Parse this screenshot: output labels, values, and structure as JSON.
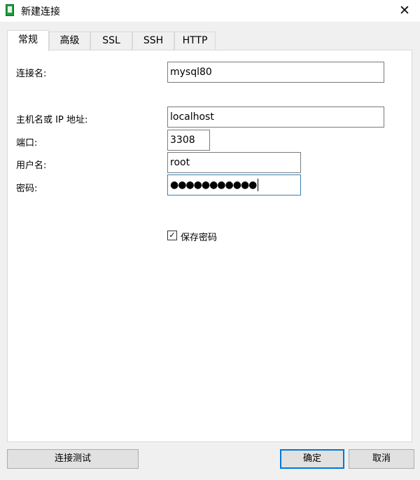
{
  "window": {
    "title": "新建连接"
  },
  "tabs": [
    {
      "label": "常规",
      "active": true
    },
    {
      "label": "高级",
      "active": false
    },
    {
      "label": "SSL",
      "active": false
    },
    {
      "label": "SSH",
      "active": false
    },
    {
      "label": "HTTP",
      "active": false
    }
  ],
  "form": {
    "connection_name_label": "连接名:",
    "connection_name_value": "mysql80",
    "host_label": "主机名或 IP 地址:",
    "host_value": "localhost",
    "port_label": "端口:",
    "port_value": "3308",
    "user_label": "用户名:",
    "user_value": "root",
    "password_label": "密码:",
    "password_masked": "●●●●●●●●●●●",
    "save_password_label": "保存密码",
    "save_password_checked": true
  },
  "buttons": {
    "test_label": "连接测试",
    "ok_label": "确定",
    "cancel_label": "取消"
  },
  "icons": {
    "app": "database-connection-icon",
    "close": "close-icon",
    "check": "checkmark-icon"
  },
  "colors": {
    "focus_border": "#3c7fb1",
    "default_button_border": "#0078d7",
    "app_icon": "#1e9e3e"
  }
}
